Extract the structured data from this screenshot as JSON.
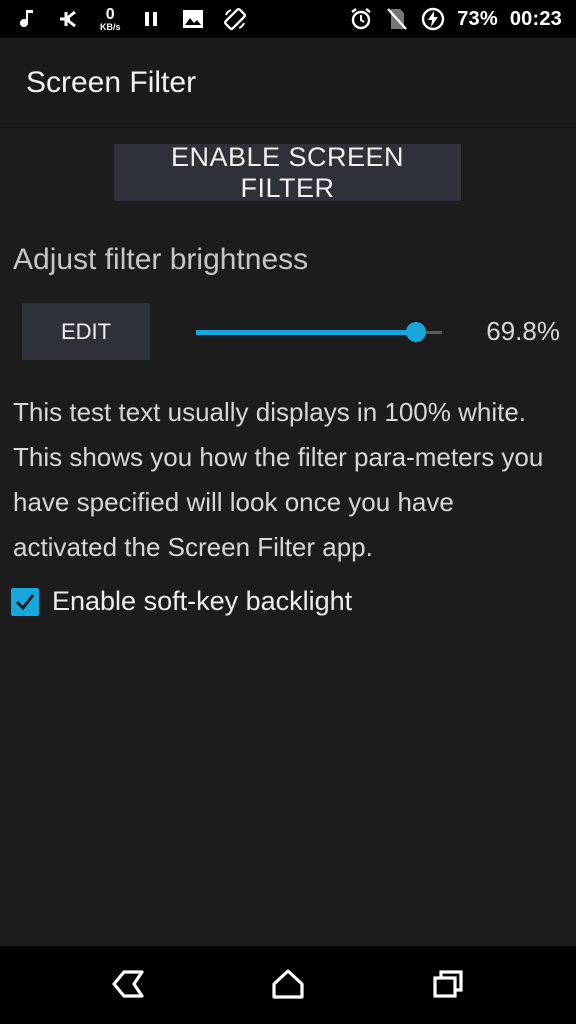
{
  "status_bar": {
    "net_speed": "0",
    "net_unit": "KB/s",
    "battery": "73%",
    "time": "00:23",
    "icons_left": [
      "music-note-icon",
      "bluetooth-k-icon",
      "net-speed",
      "pause-icon",
      "image-icon",
      "screen-rotation-icon"
    ],
    "icons_right": [
      "alarm-icon",
      "no-sim-icon",
      "battery-charging-icon"
    ]
  },
  "app_bar": {
    "title": "Screen Filter"
  },
  "main": {
    "enable_button_label": "ENABLE SCREEN FILTER",
    "section_title": "Adjust filter brightness",
    "edit_button_label": "EDIT",
    "brightness_percent": 69.8,
    "brightness_label": "69.8%",
    "test_text": "This test text usually displays in 100% white. This shows you how the filter para-meters you have specified will look once you have activated the Screen Filter app.",
    "softkey_checkbox_label": "Enable soft-key backlight",
    "softkey_checked": true
  },
  "colors": {
    "accent": "#16a8dc",
    "background": "#1c1c1c",
    "button": "#2f3138"
  },
  "nav_bar": {
    "icons": [
      "back-icon",
      "home-icon",
      "recents-icon"
    ]
  }
}
